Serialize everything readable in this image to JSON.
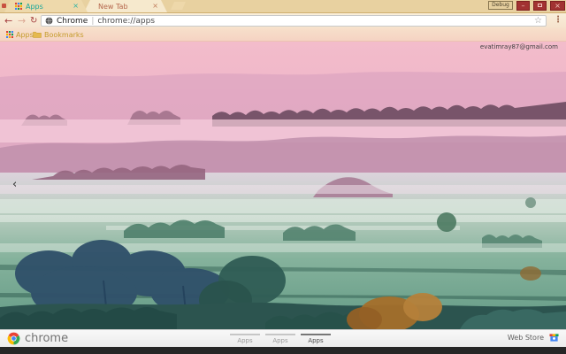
{
  "theme": {
    "frame_color": "#e8d1a0",
    "toolbar_color": "#f8ecd4",
    "bookmarks_color": "#f6d8c6",
    "accent_teal": "#17a79b",
    "window_button_red": "#a23232",
    "bookmark_gold": "#c49b2a"
  },
  "tabstrip": {
    "tabs": [
      {
        "label": "Apps",
        "active": true,
        "close_glyph": "×"
      },
      {
        "label": "New Tab",
        "active": false,
        "close_glyph": "×"
      }
    ],
    "debug_label": "Debug",
    "controls": {
      "minimize": "–",
      "close": "×"
    }
  },
  "toolbar": {
    "back_glyph": "←",
    "forward_glyph": "→",
    "reload_glyph": "↻",
    "omnibox": {
      "site_name": "Chrome",
      "separator": "|",
      "url": "chrome://apps",
      "star_glyph": "☆"
    },
    "menu_glyph": "⋮"
  },
  "bookmarks_bar": {
    "items": [
      {
        "label": "Apps"
      },
      {
        "label": "Bookmarks"
      }
    ]
  },
  "apps_page": {
    "profile_email": "evatimray87@gmail.com",
    "page_back_glyph": "‹"
  },
  "launcher": {
    "brand": "chrome",
    "pages": [
      {
        "label": "Apps",
        "active": false
      },
      {
        "label": "Apps",
        "active": false
      },
      {
        "label": "Apps",
        "active": true
      }
    ],
    "web_store_label": "Web Store"
  }
}
